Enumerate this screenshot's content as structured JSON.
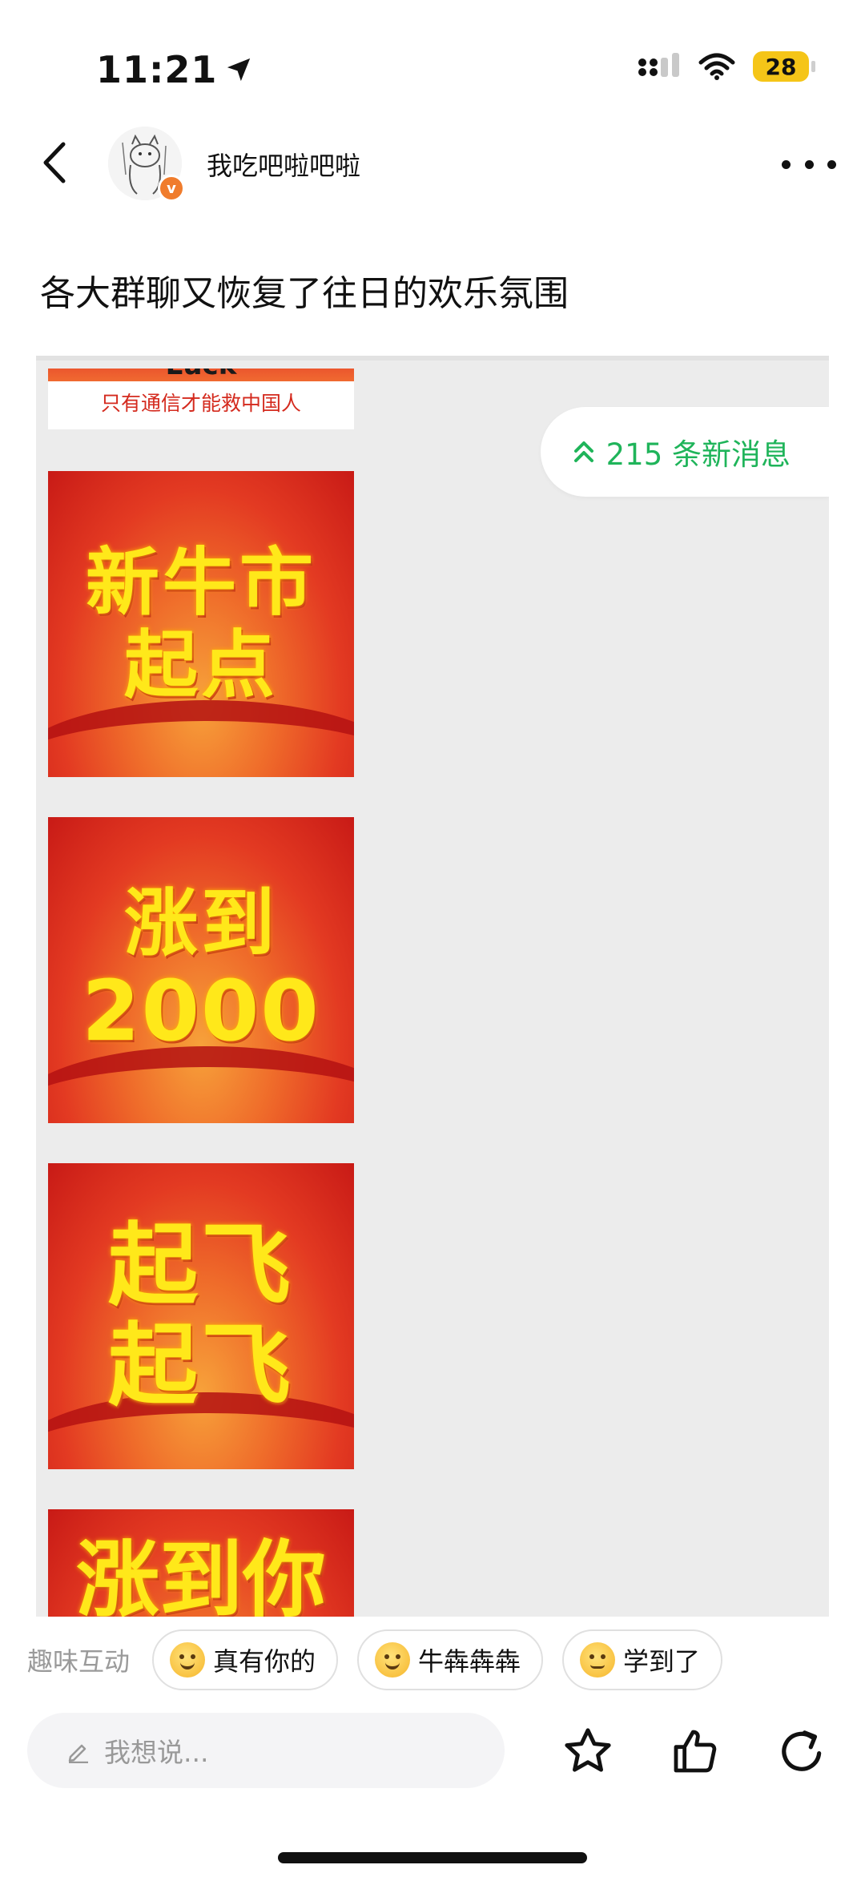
{
  "status_bar": {
    "time": "11:21",
    "battery": "28"
  },
  "header": {
    "username": "我吃吧啦吧啦"
  },
  "post": {
    "title": "各大群聊又恢复了往日的欢乐氛围",
    "stickers": [
      {
        "banner": "Luck",
        "caption": "只有通信才能救中国人"
      },
      {
        "lines": [
          "新牛市",
          "起点"
        ]
      },
      {
        "lines": [
          "涨到",
          "2000"
        ]
      },
      {
        "lines": [
          "起飞",
          "起飞"
        ]
      },
      {
        "lines": [
          "涨到你"
        ]
      }
    ],
    "new_messages": "215 条新消息"
  },
  "interaction": {
    "label": "趣味互动",
    "chips": [
      {
        "label": "真有你的",
        "icon": "laughing-emoji-icon"
      },
      {
        "label": "牛犇犇犇",
        "icon": "smile-emoji-icon"
      },
      {
        "label": "学到了",
        "icon": "slight-smile-emoji-icon"
      }
    ]
  },
  "bottom_bar": {
    "placeholder": "我想说..."
  },
  "colors": {
    "accent_green": "#1fb45a",
    "verified_orange": "#f07c2c",
    "battery_yellow": "#f5c518",
    "sticker_text": "#ffe81a"
  }
}
